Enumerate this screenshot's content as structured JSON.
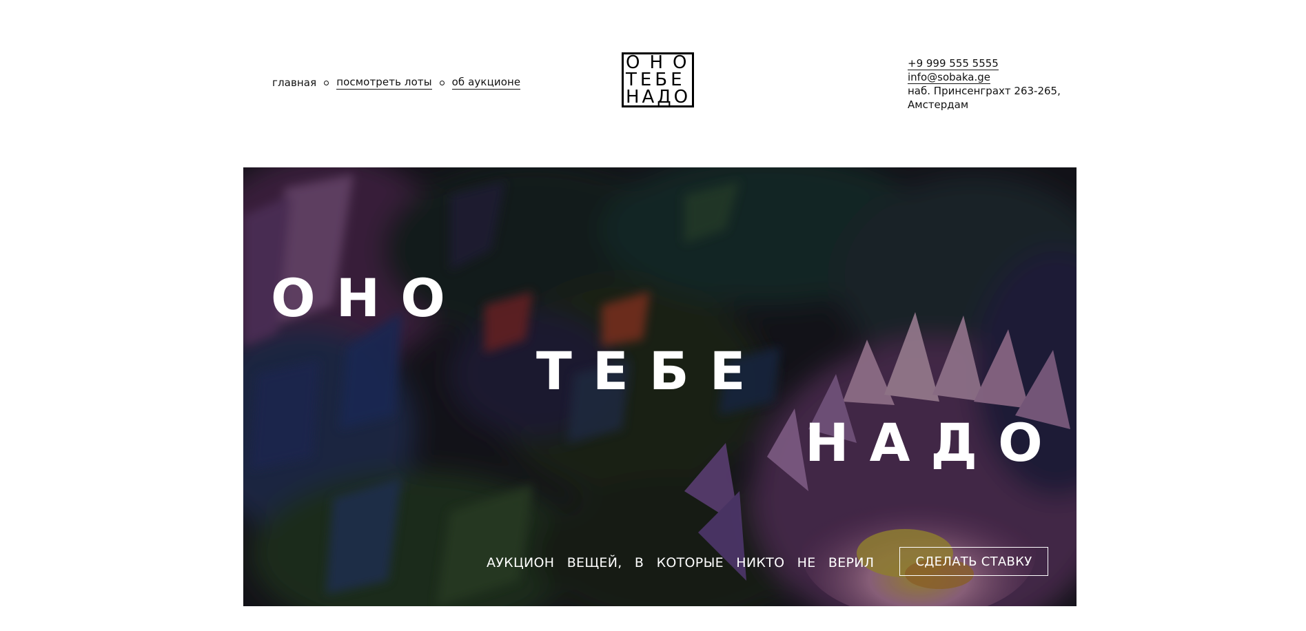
{
  "nav": {
    "items": [
      {
        "label": "главная",
        "linked": false
      },
      {
        "label": "посмотреть лоты",
        "linked": true
      },
      {
        "label": "об аукционе",
        "linked": true
      }
    ]
  },
  "logo": {
    "lines": [
      "ОНО",
      "ТЕБЕ",
      "НАДО"
    ]
  },
  "contacts": {
    "phone": "+9 999 555 5555",
    "email": "info@sobaka.ge",
    "address_line1": "наб. Принсенграхт 263-265,",
    "address_line2": "Амстердам"
  },
  "hero": {
    "word1": "ОНО",
    "word2": "ТЕБЕ",
    "word3": "НАДО",
    "tagline": "АУКЦИОН ВЕЩЕЙ, В КОТОРЫЕ НИКТО НЕ ВЕРИЛ",
    "cta_label": "СДЕЛАТЬ СТАВКУ"
  }
}
